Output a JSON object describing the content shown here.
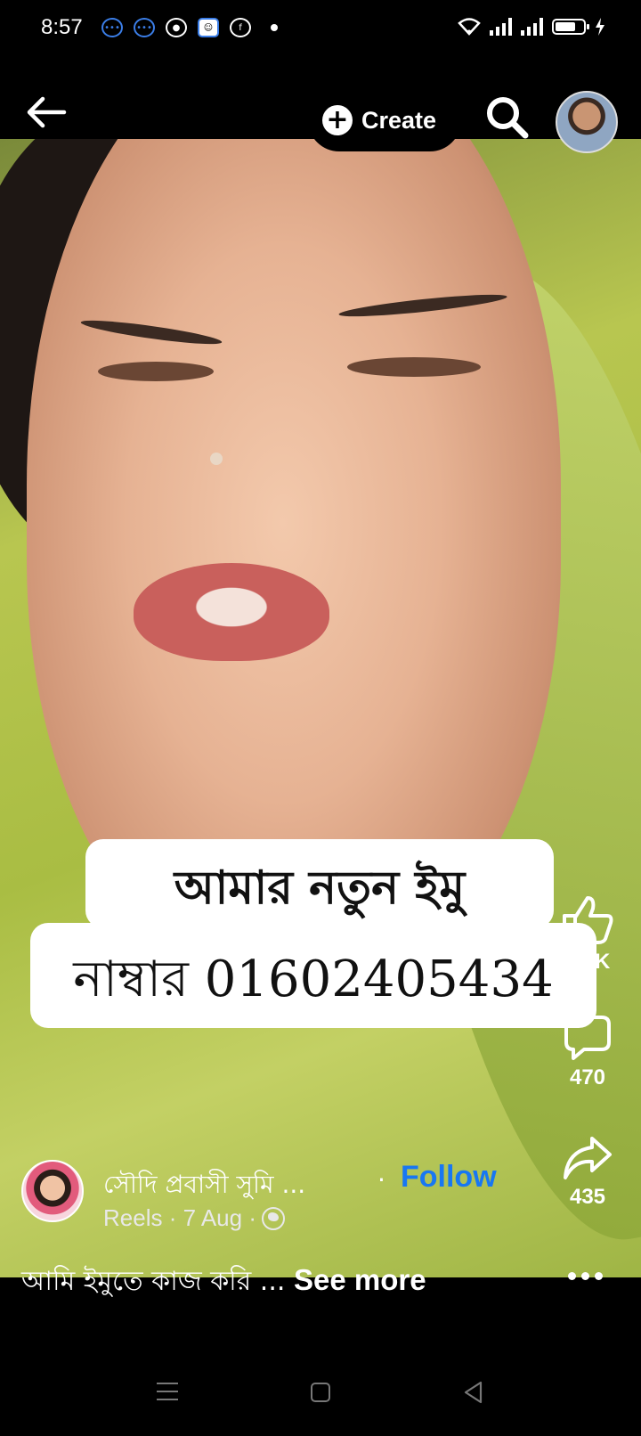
{
  "status_bar": {
    "time": "8:57",
    "notifications": [
      "messenger-icon",
      "messenger-icon",
      "chat-icon",
      "snapchat-icon",
      "facebook-icon",
      "more-dot"
    ]
  },
  "top_bar": {
    "create_label": "Create"
  },
  "video": {
    "caption_line1": "আমার নতুন ইমু",
    "caption_line2": "নাম্বার 01602405434"
  },
  "actions": {
    "like_count": "5.3K",
    "comment_count": "470",
    "share_count": "435"
  },
  "author": {
    "name": "সৌদি প্রবাসী সুমি ...",
    "dot": "·",
    "follow_label": "Follow",
    "meta": "Reels · 7 Aug ·"
  },
  "description": {
    "text": "আমি ইমুতে কাজ করি ...",
    "see_more": "See more"
  },
  "colors": {
    "follow": "#1877f2",
    "background": "#000000"
  }
}
